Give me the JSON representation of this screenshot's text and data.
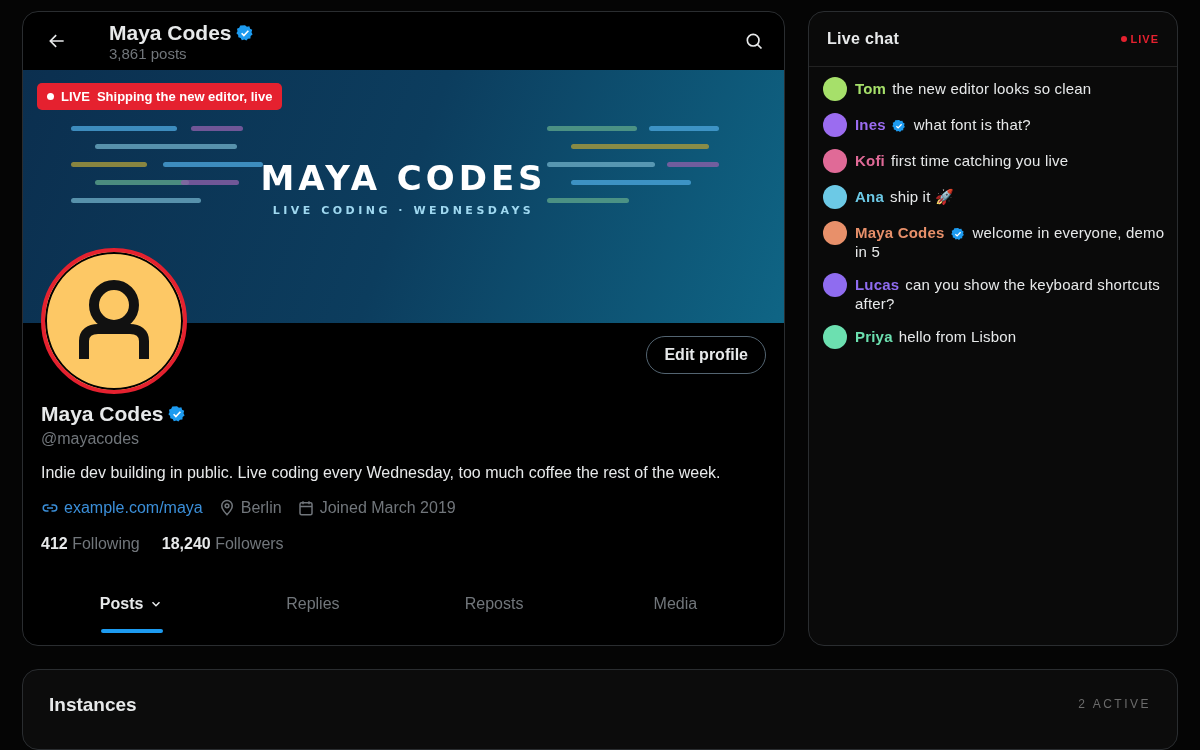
{
  "profile_header": {
    "name": "Maya Codes",
    "verified": true,
    "posts_count": "3,861 posts"
  },
  "banner": {
    "live_label": "LIVE",
    "live_title": "Shipping the new editor, live",
    "title": "MAYA CODES",
    "subtitle": "LIVE CODING · WEDNESDAYS"
  },
  "profile": {
    "live": true,
    "edit_button": "Edit profile",
    "name": "Maya Codes",
    "verified": true,
    "handle": "@mayacodes",
    "bio": "Indie dev building in public. Live coding every Wednesday, too much coffee the rest of the week.",
    "link": "example.com/maya",
    "location": "Berlin",
    "joined": "Joined March 2019",
    "following_count": "412",
    "following_label": "Following",
    "followers_count": "18,240",
    "followers_label": "Followers"
  },
  "tabs": [
    {
      "label": "Posts",
      "selected": true,
      "dropdown": true
    },
    {
      "label": "Replies",
      "selected": false,
      "dropdown": false
    },
    {
      "label": "Reposts",
      "selected": false,
      "dropdown": false
    },
    {
      "label": "Media",
      "selected": false,
      "dropdown": false
    }
  ],
  "chat": {
    "title": "Live chat",
    "status": "LIVE",
    "messages": [
      {
        "user": "Tom",
        "color": "#a6e06a",
        "verified": false,
        "text": "the new editor looks so clean"
      },
      {
        "user": "Ines",
        "color": "#9b6cf0",
        "verified": true,
        "text": "what font is that?"
      },
      {
        "user": "Kofi",
        "color": "#e06a97",
        "verified": false,
        "text": "first time catching you live"
      },
      {
        "user": "Ana",
        "color": "#6cc9e6",
        "verified": false,
        "text": "ship it 🚀"
      },
      {
        "user": "Maya Codes",
        "color": "#e8906a",
        "verified": true,
        "text": "welcome in everyone, demo in 5"
      },
      {
        "user": "Lucas",
        "color": "#8f6cf0",
        "verified": false,
        "text": "can you show the keyboard shortcuts after?"
      },
      {
        "user": "Priya",
        "color": "#6ce0b0",
        "verified": false,
        "text": "hello from Lisbon"
      }
    ]
  },
  "instances": {
    "title": "Instances",
    "count": "2 ACTIVE"
  }
}
